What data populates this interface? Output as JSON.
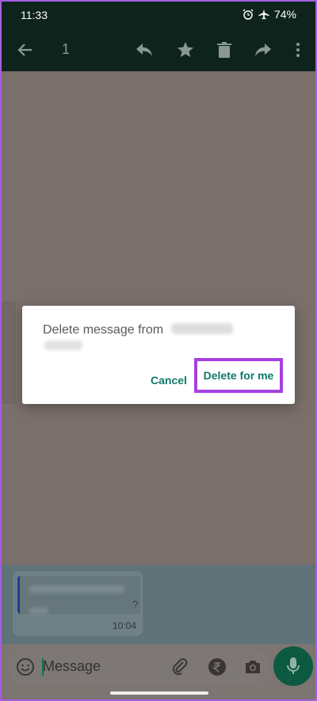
{
  "status_bar": {
    "time": "11:33",
    "battery": "74%",
    "icons": [
      "alarm-icon",
      "airplane-mode-icon"
    ]
  },
  "toolbar": {
    "selected_count": "1",
    "icons": [
      "back-arrow-icon",
      "reply-icon",
      "star-icon",
      "delete-icon",
      "forward-icon",
      "more-options-icon"
    ]
  },
  "dialog": {
    "message": "Delete message from",
    "cancel_label": "Cancel",
    "delete_label": "Delete for me",
    "accent_color": "#0f7a66",
    "highlight_color": "#a540e0"
  },
  "message_bubble": {
    "time": "10:04",
    "question_mark": "?"
  },
  "input": {
    "placeholder": "Message",
    "icons": [
      "emoji-icon",
      "attach-icon",
      "rupee-payment-icon",
      "camera-icon",
      "microphone-icon"
    ]
  }
}
